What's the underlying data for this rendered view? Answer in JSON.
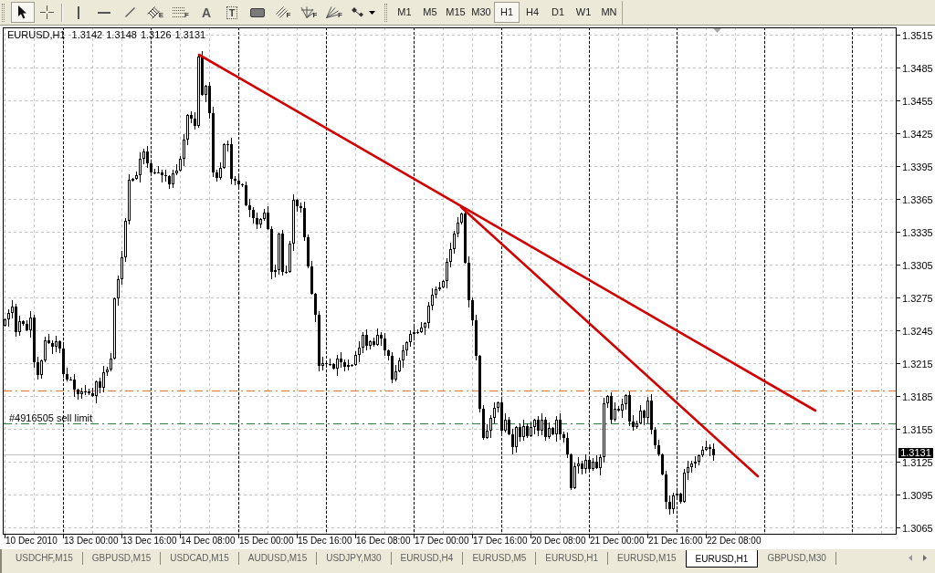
{
  "toolbar": {
    "tool_groups": [
      [
        {
          "kind": "cursor",
          "selected": true
        },
        {
          "kind": "crosshair",
          "selected": false
        }
      ],
      [
        {
          "kind": "vertical_line",
          "selected": false
        },
        {
          "kind": "horizontal_line",
          "selected": false
        },
        {
          "kind": "trend_line",
          "selected": false
        },
        {
          "kind": "channel",
          "badge": "E",
          "selected": false
        },
        {
          "kind": "fibonacci",
          "badge": "F",
          "selected": false
        },
        {
          "kind": "text",
          "glyph": "A",
          "selected": false
        },
        {
          "kind": "text_label",
          "glyph": "T",
          "selected": false
        },
        {
          "kind": "rectangle",
          "selected": false
        },
        {
          "kind": "fibo_channel",
          "badge": "F",
          "selected": false
        },
        {
          "kind": "fibo_fan",
          "badge": "F",
          "selected": false
        },
        {
          "kind": "fibo_expansion",
          "badge": "F",
          "selected": false
        },
        {
          "kind": "arrows",
          "selected": false
        }
      ]
    ],
    "timeframes": [
      {
        "label": "M1",
        "selected": false
      },
      {
        "label": "M5",
        "selected": false
      },
      {
        "label": "M15",
        "selected": false
      },
      {
        "label": "M30",
        "selected": false
      },
      {
        "label": "H1",
        "selected": true
      },
      {
        "label": "H4",
        "selected": false
      },
      {
        "label": "D1",
        "selected": false
      },
      {
        "label": "W1",
        "selected": false
      },
      {
        "label": "MN",
        "selected": false
      }
    ]
  },
  "chart": {
    "symbol": "EURUSD,H1",
    "ohlc": [
      "1.3142",
      "1.3148",
      "1.3126",
      "1.3131"
    ],
    "order_label": "#4916505 sell limit",
    "price_labels": [
      "1.3515",
      "1.3485",
      "1.3455",
      "1.3425",
      "1.3395",
      "1.3365",
      "1.3335",
      "1.3305",
      "1.3275",
      "1.3245",
      "1.3215",
      "1.3185",
      "1.3155",
      "1.3125",
      "1.3095",
      "1.3065"
    ],
    "current_price": "1.3131",
    "time_labels": [
      "10 Dec 2010",
      "13 Dec 00:00",
      "13 Dec 16:00",
      "14 Dec 08:00",
      "15 Dec 00:00",
      "15 Dec 16:00",
      "16 Dec 08:00",
      "17 Dec 00:00",
      "17 Dec 16:00",
      "20 Dec 08:00",
      "21 Dec 00:00",
      "21 Dec 16:00",
      "22 Dec 08:00"
    ]
  },
  "chart_tabs": [
    {
      "label": "USDCHF,M15",
      "selected": false
    },
    {
      "label": "GBPUSD,M15",
      "selected": false
    },
    {
      "label": "USDCAD,M15",
      "selected": false
    },
    {
      "label": "AUDUSD,M15",
      "selected": false
    },
    {
      "label": "USDJPY,M30",
      "selected": false
    },
    {
      "label": "EURUSD,H4",
      "selected": false
    },
    {
      "label": "EURUSD,M5",
      "selected": false
    },
    {
      "label": "EURUSD,H1",
      "selected": false
    },
    {
      "label": "EURUSD,M15",
      "selected": false
    },
    {
      "label": "EURUSD,H1",
      "selected": true
    },
    {
      "label": "GBPUSD,M30",
      "selected": false
    }
  ]
}
